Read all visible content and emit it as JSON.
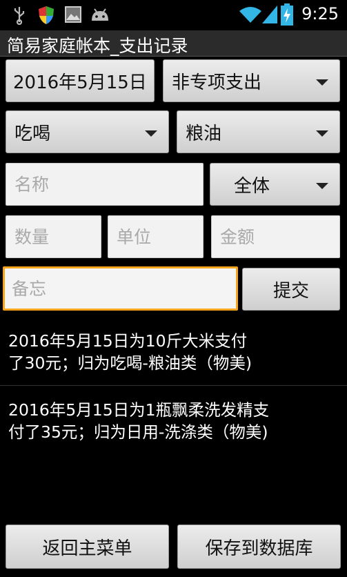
{
  "status_bar": {
    "time": "9:25",
    "icons": [
      "usb-icon",
      "shield-icon",
      "image-icon",
      "android-icon",
      "wifi-icon",
      "signal-icon",
      "battery-charging-icon"
    ]
  },
  "app": {
    "title": "简易家庭帐本_支出记录"
  },
  "form": {
    "date_button": "2016年5月15日",
    "expense_type": "非专项支出",
    "category": "吃喝",
    "subcategory": "粮油",
    "name_placeholder": "名称",
    "scope": "全体",
    "quantity_placeholder": "数量",
    "unit_placeholder": "单位",
    "amount_placeholder": "金额",
    "note_placeholder": "备忘",
    "submit_label": "提交"
  },
  "records": [
    {
      "line1": "2016年5月15日为10斤大米支付",
      "line2": "了30元；归为吃喝-粮油类（物美)"
    },
    {
      "line1": "2016年5月15日为1瓶飘柔洗发精支",
      "line2": "付了35元；归为日用-洗涤类（物美)"
    }
  ],
  "footer": {
    "back_label": "返回主菜单",
    "save_label": "保存到数据库"
  },
  "colors": {
    "focus": "#f7a51e",
    "background": "#000000",
    "status_icon_green": "#33b5e5"
  }
}
